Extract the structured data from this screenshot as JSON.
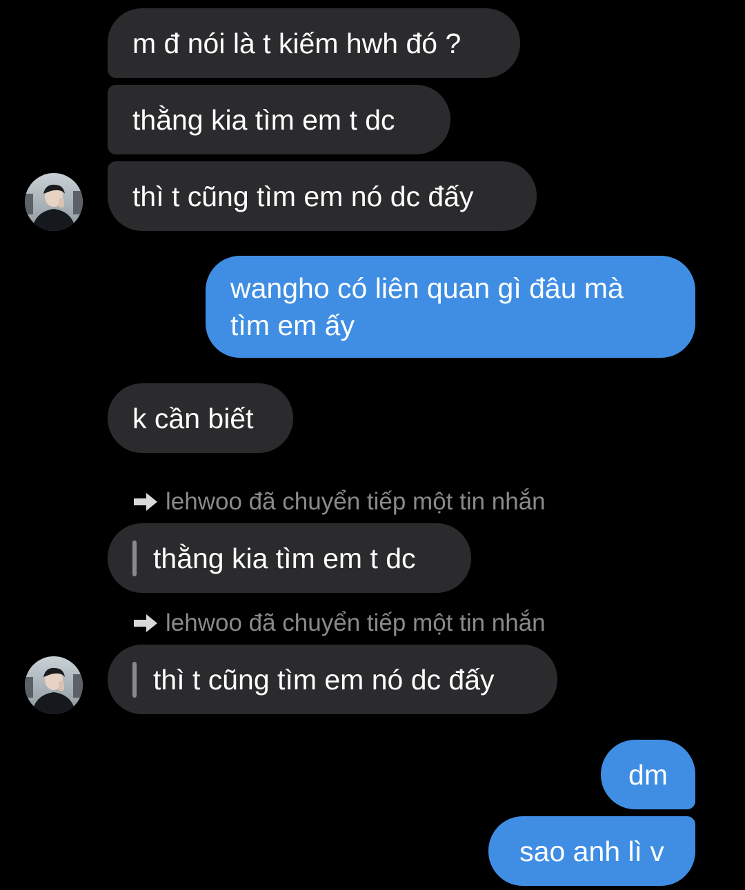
{
  "conversation": {
    "incoming_group_1": [
      {
        "text": "m đ nói là t kiếm hwh đó ?"
      },
      {
        "text": "thằng kia tìm em t dc"
      },
      {
        "text": "thì t cũng tìm em nó dc đấy"
      }
    ],
    "outgoing_1": {
      "lines": [
        "wangho có liên quan gì đâu mà",
        "tìm em ấy"
      ]
    },
    "incoming_2": {
      "text": "k cần biết"
    },
    "forwarded": [
      {
        "note": "lehwoo đã chuyển tiếp một tin nhắn",
        "text": "thằng kia tìm em t dc"
      },
      {
        "note": "lehwoo đã chuyển tiếp một tin nhắn",
        "text": "thì t cũng tìm em nó dc đấy"
      }
    ],
    "outgoing_2": [
      {
        "text": "dm"
      },
      {
        "text": "sao anh lì v"
      }
    ]
  },
  "icons": {
    "avatar": "avatar-icon",
    "forward": "forward-arrow-icon"
  },
  "colors": {
    "background": "#000000",
    "incoming_bubble": "#2b2b2d",
    "outgoing_bubble": "#3f8ee4",
    "note_text": "#8a8a8d"
  }
}
